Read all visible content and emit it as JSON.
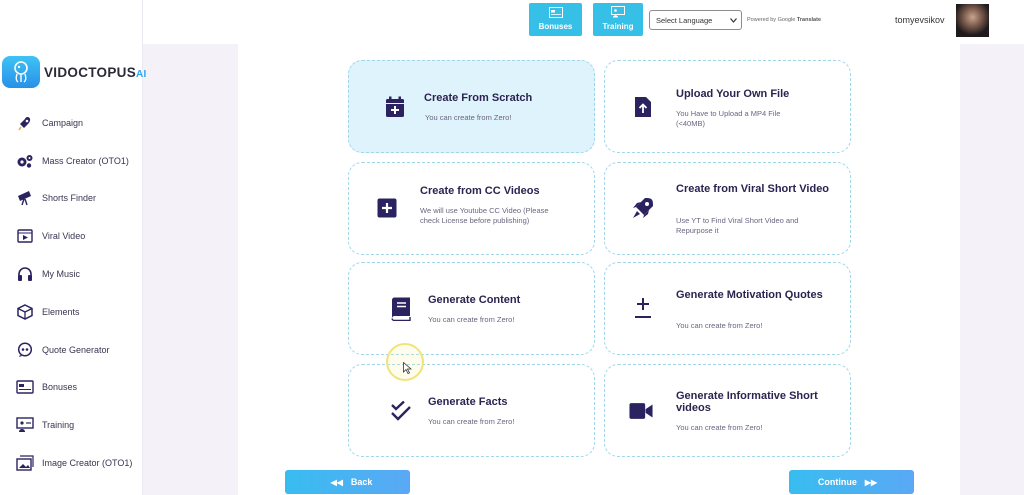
{
  "brand": {
    "name_main": "VIDOCTOPUS",
    "name_suffix": "AI"
  },
  "sidebar": {
    "items": [
      {
        "label": "Campaign",
        "icon": "rocket-icon"
      },
      {
        "label": "Mass Creator (OTO1)",
        "icon": "gears-icon"
      },
      {
        "label": "Shorts Finder",
        "icon": "telescope-icon"
      },
      {
        "label": "Viral Video",
        "icon": "video-play-icon"
      },
      {
        "label": "My Music",
        "icon": "headphones-icon"
      },
      {
        "label": "Elements",
        "icon": "cube-icon"
      },
      {
        "label": "Quote Generator",
        "icon": "quote-bubble-icon"
      },
      {
        "label": "Bonuses",
        "icon": "gift-card-icon"
      },
      {
        "label": "Training",
        "icon": "presentation-icon"
      },
      {
        "label": "Image Creator (OTO1)",
        "icon": "image-stack-icon"
      }
    ]
  },
  "topbar": {
    "bonuses_label": "Bonuses",
    "training_label": "Training",
    "language_select": "Select Language",
    "powered_by": "Powered by",
    "google": "Google",
    "translate": "Translate",
    "username": "tomyevsikov"
  },
  "cards": [
    {
      "title": "Create From Scratch",
      "desc": "You can create from Zero!",
      "icon": "calendar-plus-icon",
      "selected": true
    },
    {
      "title": "Upload Your Own File",
      "desc": "You Have to Upload a MP4 File (<40MB)",
      "icon": "file-upload-icon"
    },
    {
      "title": "Create from CC Videos",
      "desc": "We will use Youtube CC Video (Please check License before publishing)",
      "icon": "plus-square-icon"
    },
    {
      "title": "Create from Viral Short Video",
      "desc": "Use YT to Find Viral Short Video and Repurpose it",
      "icon": "rocket-icon"
    },
    {
      "title": "Generate Content",
      "desc": "You can create from Zero!",
      "icon": "book-icon"
    },
    {
      "title": "Generate Motivation Quotes",
      "desc": "You can create from Zero!",
      "icon": "plus-minus-icon"
    },
    {
      "title": "Generate Facts",
      "desc": "You can create from Zero!",
      "icon": "double-check-icon"
    },
    {
      "title": "Generate Informative Short videos",
      "desc": "You can create from Zero!",
      "icon": "video-camera-icon"
    }
  ],
  "footer": {
    "back_label": "Back",
    "continue_label": "Continue"
  },
  "colors": {
    "accent": "#36c0e8",
    "icon_dark": "#2b2360",
    "selected_bg": "#dff3fc"
  }
}
